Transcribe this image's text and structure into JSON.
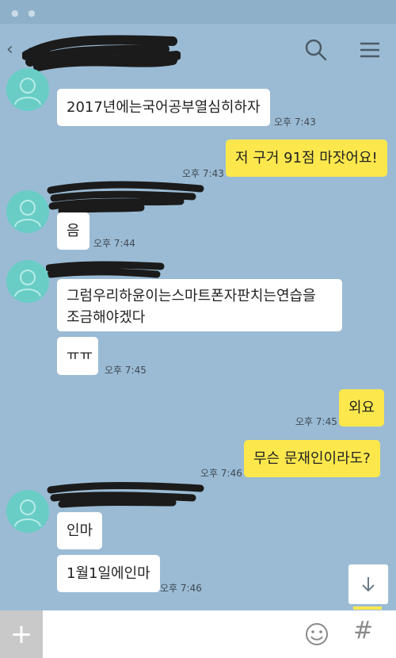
{
  "header": {
    "back_glyph": "‹",
    "icons": [
      "search-icon",
      "menu-icon"
    ]
  },
  "messages": [
    {
      "id": "m1",
      "sender": "other",
      "text": "2017년에는국어공부열심히하자",
      "time": "오후 7:43"
    },
    {
      "id": "m2",
      "sender": "me",
      "text": "저 구거 91점 마잣어요!",
      "time": "오후 7:43"
    },
    {
      "id": "m3",
      "sender": "other",
      "text": "음",
      "time": "오후 7:44"
    },
    {
      "id": "m4",
      "sender": "other",
      "text_line1": "그럼우리하윤이는스마트폰자판치는연습을",
      "text_line2": "조금해야겠다"
    },
    {
      "id": "m5",
      "sender": "other",
      "text": "ㅠㅠ",
      "time": "오후 7:45"
    },
    {
      "id": "m6",
      "sender": "me",
      "text": "외요",
      "time": "오후 7:45"
    },
    {
      "id": "m7",
      "sender": "me",
      "text": "무슨 문재인이라도?",
      "time": "오후 7:46"
    },
    {
      "id": "m8",
      "sender": "other",
      "text": "인마"
    },
    {
      "id": "m9",
      "sender": "other",
      "text": "1월1일에인마",
      "time": "오후 7:46"
    }
  ],
  "composer": {
    "plus_label": "+",
    "hash_label": "#"
  },
  "colors": {
    "background": "#9bbbd4",
    "my_bubble": "#fce84d",
    "their_bubble": "#ffffff",
    "avatar": "#69cdc6"
  }
}
